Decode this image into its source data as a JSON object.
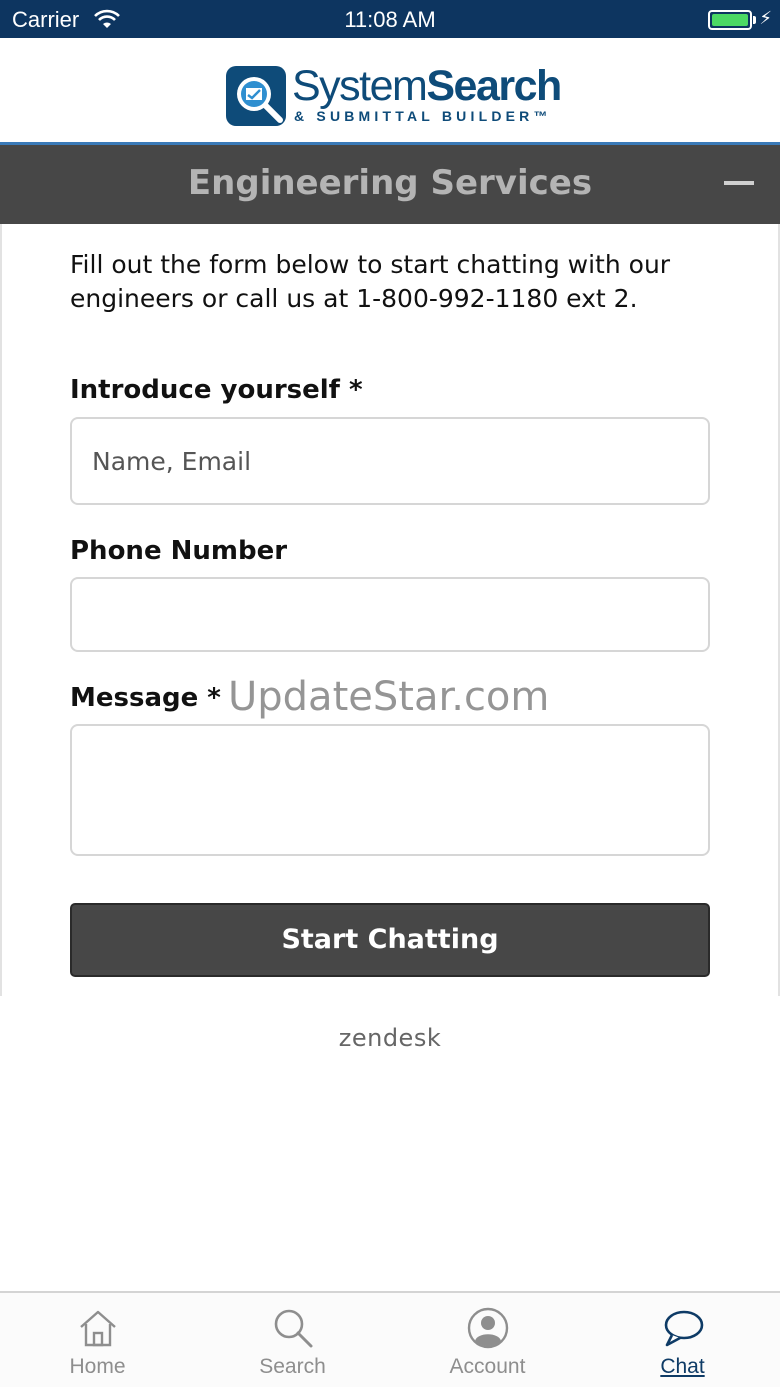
{
  "status_bar": {
    "carrier": "Carrier",
    "time": "11:08 AM",
    "battery_percent": 100
  },
  "logo": {
    "title_regular": "System",
    "title_bold": "Search",
    "subtitle": "& SUBMITTAL BUILDER™"
  },
  "panel": {
    "title": "Engineering Services"
  },
  "form": {
    "intro": "Fill out the form below to start chatting with our engineers or call us at 1-800-992-1180 ext 2.",
    "name_label": "Introduce yourself *",
    "name_placeholder": "Name, Email",
    "phone_label": "Phone Number",
    "message_label": "Message *",
    "submit_label": "Start Chatting"
  },
  "watermark": "UpdateStar.com",
  "powered_by": "zendesk",
  "tab_bar": {
    "items": [
      {
        "label": "Home",
        "icon": "home-icon"
      },
      {
        "label": "Search",
        "icon": "search-icon"
      },
      {
        "label": "Account",
        "icon": "account-icon"
      },
      {
        "label": "Chat",
        "icon": "chat-icon",
        "active": true
      }
    ]
  },
  "colors": {
    "status_bar": "#0d3560",
    "brand": "#0e4b79",
    "panel_header": "#474747",
    "active_tab": "#0e3b66",
    "battery": "#4cd964"
  }
}
